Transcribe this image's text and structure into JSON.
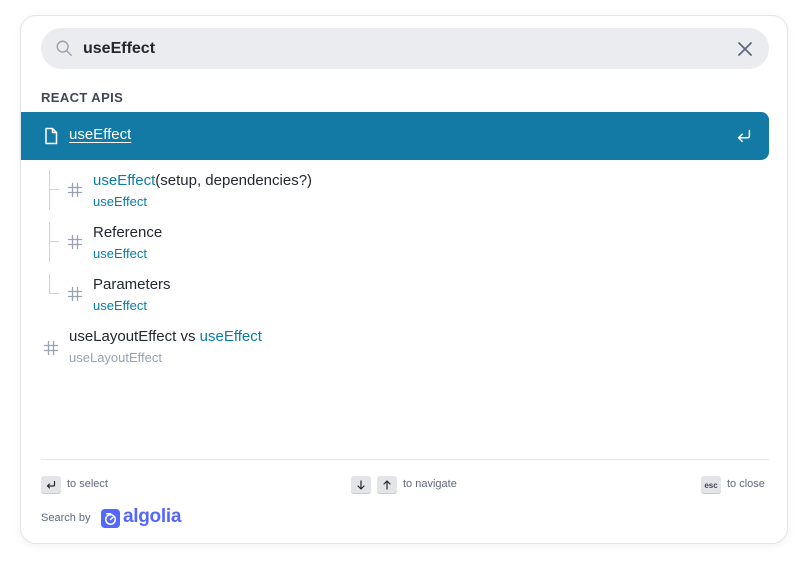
{
  "search": {
    "value": "useEffect",
    "placeholder": "Search"
  },
  "section": {
    "title": "REACT APIS"
  },
  "selected_hit": {
    "title": "useEffect"
  },
  "children": [
    {
      "title_highlight": "useEffect",
      "title_rest": "(setup, dependencies?)",
      "subtitle": "useEffect"
    },
    {
      "title_highlight": "",
      "title_rest": "Reference",
      "subtitle": "useEffect"
    },
    {
      "title_highlight": "",
      "title_rest": "Parameters",
      "subtitle": "useEffect"
    }
  ],
  "other_hit": {
    "title_prefix": "useLayoutEffect vs ",
    "title_highlight": "useEffect",
    "subtitle": "useLayoutEffect"
  },
  "footer": {
    "select_hint": "to select",
    "navigate_hint": "to navigate",
    "esc_key": "esc",
    "close_hint": "to close",
    "search_by": "Search by",
    "brand": "algolia"
  },
  "colors": {
    "selected_bg": "#127aa5",
    "highlight": "#087ea4",
    "algolia_blue": "#5468ff"
  },
  "icons": [
    "search-icon",
    "clear-icon",
    "document-icon",
    "enter-icon",
    "hash-icon",
    "arrow-down-icon",
    "arrow-up-icon",
    "algolia-logo-icon"
  ]
}
